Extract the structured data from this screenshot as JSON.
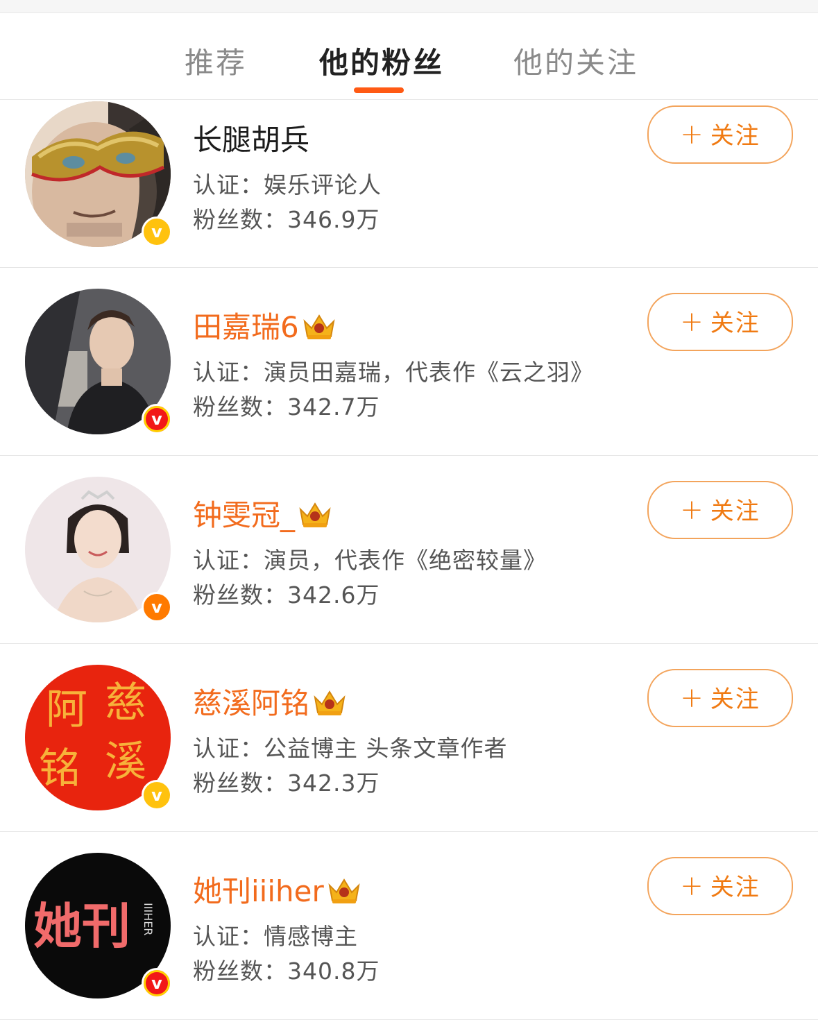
{
  "tabs": [
    {
      "label": "推荐",
      "active": false
    },
    {
      "label": "他的粉丝",
      "active": true
    },
    {
      "label": "他的关注",
      "active": false
    }
  ],
  "accent_color": "#ff5a14",
  "vip_name_color": "#f26b1d",
  "follow_label": "关注",
  "follow_icon": "plus-icon",
  "users": [
    {
      "name": "长腿胡兵",
      "vip": false,
      "cert_label": "认证：",
      "cert": "娱乐评论人",
      "fans_label": "粉丝数：",
      "fans": "346.9万",
      "badge": "yellow",
      "avatar": "masked-man-photo"
    },
    {
      "name": "田嘉瑞6",
      "vip": true,
      "cert_label": "认证：",
      "cert": "演员田嘉瑞，代表作《云之羽》",
      "fans_label": "粉丝数：",
      "fans": "342.7万",
      "badge": "red",
      "avatar": "young-man-photo"
    },
    {
      "name": "钟雯冠_",
      "vip": true,
      "cert_label": "认证：",
      "cert": "演员，代表作《绝密较量》",
      "fans_label": "粉丝数：",
      "fans": "342.6万",
      "badge": "orange",
      "avatar": "woman-tiara-photo"
    },
    {
      "name": "慈溪阿铭",
      "vip": true,
      "cert_label": "认证：",
      "cert": "公益博主 头条文章作者",
      "fans_label": "粉丝数：",
      "fans": "342.3万",
      "badge": "yellow",
      "avatar": "red-calligraphy-logo",
      "avatar_text": [
        "阿",
        "慈",
        "铭",
        "溪"
      ]
    },
    {
      "name": "她刊iiiher",
      "vip": true,
      "cert_label": "认证：",
      "cert": "情感博主",
      "fans_label": "粉丝数：",
      "fans": "340.8万",
      "badge": "red",
      "avatar": "black-circle-logo",
      "avatar_text": [
        "她刊",
        "IIIHER"
      ]
    }
  ]
}
